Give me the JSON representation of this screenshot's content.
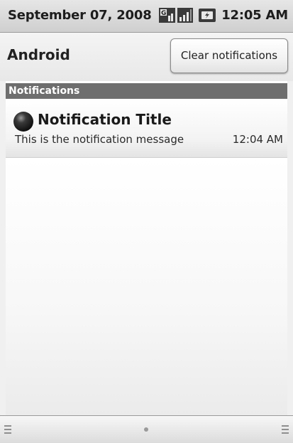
{
  "status_bar": {
    "date": "September 07, 2008",
    "time": "12:05 AM",
    "icons": [
      "network-g-icon",
      "signal-strength-icon",
      "battery-charging-icon"
    ]
  },
  "header": {
    "title": "Android",
    "clear_button_label": "Clear notifications"
  },
  "section": {
    "label": "Notifications"
  },
  "notifications": [
    {
      "icon": "notification-ball-icon",
      "title": "Notification Title",
      "message": "This is the notification message",
      "time": "12:04 AM"
    }
  ],
  "bottom_bar": {
    "icons": [
      "grip-left-icon",
      "handle-dot-icon",
      "grip-right-icon"
    ]
  }
}
